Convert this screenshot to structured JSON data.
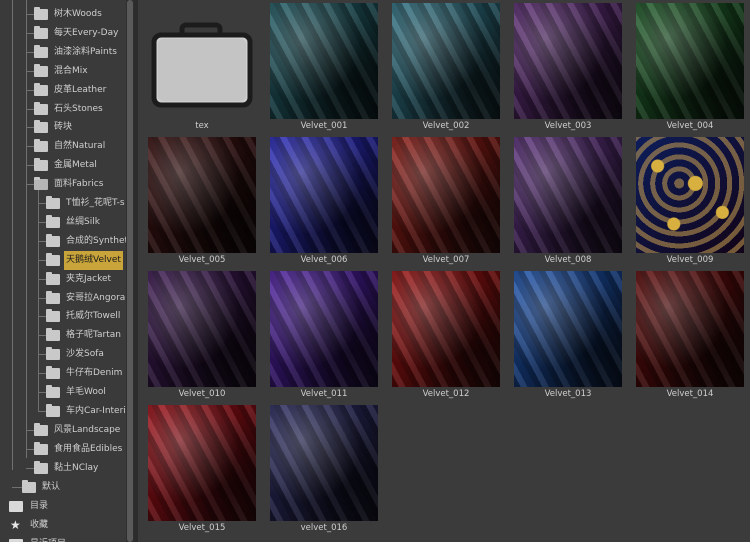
{
  "tree": {
    "items": [
      {
        "label": "树木Woods",
        "depth": 1
      },
      {
        "label": "每天Every-Day",
        "depth": 1
      },
      {
        "label": "油漆涂料Paints",
        "depth": 1
      },
      {
        "label": "混合Mix",
        "depth": 1
      },
      {
        "label": "皮革Leather",
        "depth": 1
      },
      {
        "label": "石头Stones",
        "depth": 1
      },
      {
        "label": "砖块",
        "depth": 1
      },
      {
        "label": "自然Natural",
        "depth": 1
      },
      {
        "label": "金属Metal",
        "depth": 1
      },
      {
        "label": "面料Fabrics",
        "depth": 1,
        "open": true
      },
      {
        "label": "T恤衫_花呢T-s",
        "depth": 2
      },
      {
        "label": "丝绸Silk",
        "depth": 2
      },
      {
        "label": "合成的Synthet",
        "depth": 2
      },
      {
        "label": "天鹅绒Velvet",
        "depth": 2,
        "selected": true
      },
      {
        "label": "夹克Jacket",
        "depth": 2
      },
      {
        "label": "安哥拉Angora",
        "depth": 2
      },
      {
        "label": "托威尔Towell",
        "depth": 2
      },
      {
        "label": "格子呢Tartan",
        "depth": 2
      },
      {
        "label": "沙发Sofa",
        "depth": 2
      },
      {
        "label": "牛仔布Denim",
        "depth": 2
      },
      {
        "label": "羊毛Wool",
        "depth": 2
      },
      {
        "label": "车内Car-Interi",
        "depth": 2
      },
      {
        "label": "风景Landscape",
        "depth": 1
      },
      {
        "label": "食用食品Edibles",
        "depth": 1
      },
      {
        "label": "黏土NClay",
        "depth": 1
      },
      {
        "label": "默认",
        "depth": 0
      }
    ],
    "bottom": [
      {
        "label": "目录",
        "icon": "folder-icon"
      },
      {
        "label": "收藏",
        "icon": "star-icon"
      },
      {
        "label": "最近项目",
        "icon": "folder-icon"
      }
    ]
  },
  "thumbnails": [
    {
      "label": "tex",
      "kind": "folder"
    },
    {
      "label": "Velvet_001",
      "color": "#1f5a63"
    },
    {
      "label": "Velvet_002",
      "color": "#2d6f80"
    },
    {
      "label": "Velvet_003",
      "color": "#5a2a72"
    },
    {
      "label": "Velvet_004",
      "color": "#1d5a27"
    },
    {
      "label": "Velvet_005",
      "color": "#3a1010"
    },
    {
      "label": "Velvet_006",
      "color": "#2828b8"
    },
    {
      "label": "Velvet_007",
      "color": "#8a1a14"
    },
    {
      "label": "Velvet_008",
      "color": "#5a2f7a"
    },
    {
      "label": "Velvet_009",
      "color": "#0d1d5a",
      "accent": "#d8b040"
    },
    {
      "label": "Velvet_010",
      "color": "#3b1850",
      "accent": "#c9a050"
    },
    {
      "label": "Velvet_011",
      "color": "#4a1c9c"
    },
    {
      "label": "Velvet_012",
      "color": "#9a1010"
    },
    {
      "label": "Velvet_013",
      "color": "#1a4fa8"
    },
    {
      "label": "Velvet_014",
      "color": "#5e0a0a"
    },
    {
      "label": "Velvet_015",
      "color": "#9a0e16"
    },
    {
      "label": "velvet_016",
      "color": "#2a2a60"
    }
  ]
}
